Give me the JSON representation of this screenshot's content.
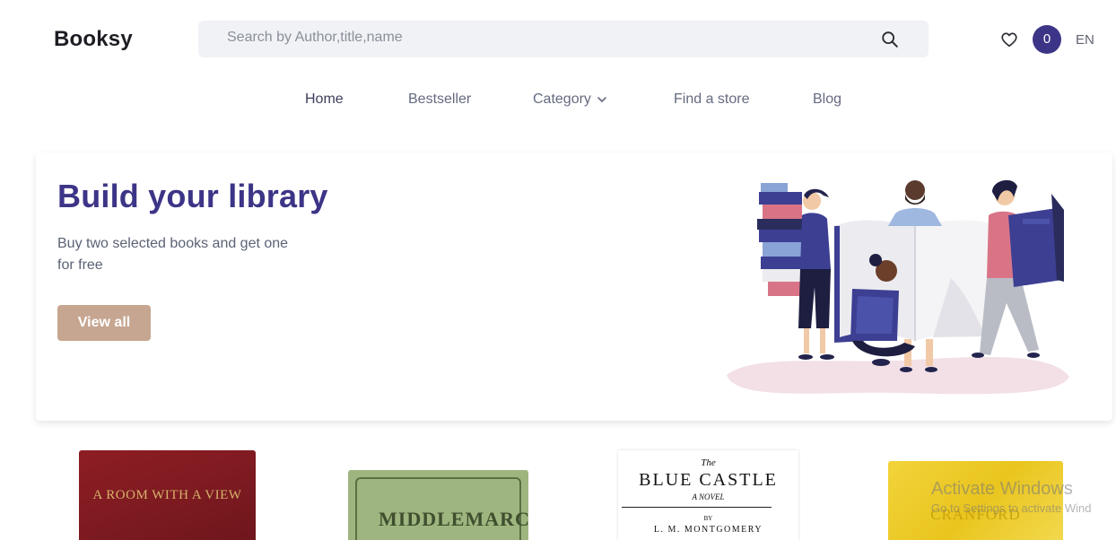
{
  "header": {
    "logo": "Booksy",
    "search_placeholder": "Search by Author,title,name",
    "cart_count": "0",
    "language": "EN"
  },
  "nav": {
    "items": [
      {
        "label": "Home",
        "active": true
      },
      {
        "label": "Bestseller",
        "active": false
      },
      {
        "label": "Category",
        "active": false
      },
      {
        "label": "Find a store",
        "active": false
      },
      {
        "label": "Blog",
        "active": false
      }
    ]
  },
  "hero": {
    "title": "Build your library",
    "subtitle": "Buy two selected books and get one for free",
    "button_label": "View all"
  },
  "books": [
    {
      "title": "A ROOM WITH A VIEW"
    },
    {
      "title": "MIDDLEMARCH"
    },
    {
      "title_small": "The",
      "title": "BLUE CASTLE",
      "subtitle": "A NOVEL",
      "by": "BY",
      "author": "L. M. MONTGOMERY"
    },
    {
      "title": "CRANFORD"
    }
  ],
  "watermark": {
    "line1": "Activate Windows",
    "line2": "Go to Settings to activate Wind"
  },
  "colors": {
    "brand": "#3c3587",
    "button": "#c6a691",
    "search_bg": "#f0f2f6"
  }
}
